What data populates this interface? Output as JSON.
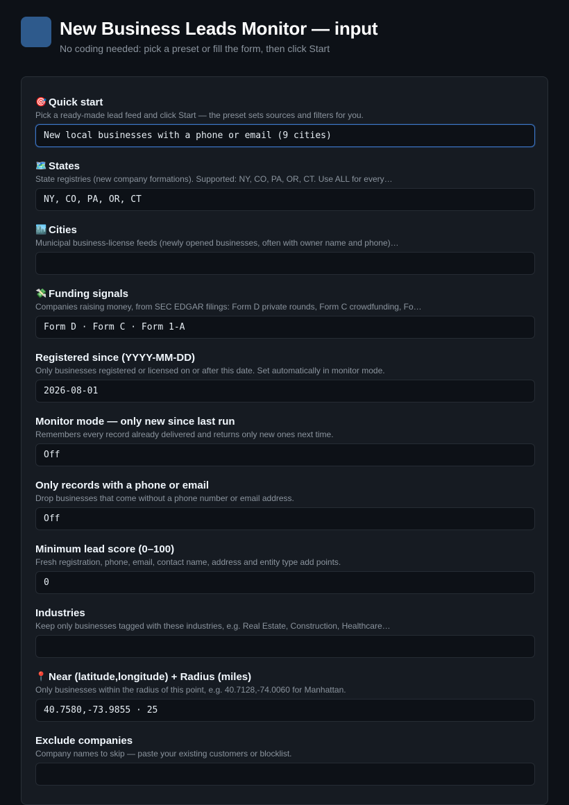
{
  "header": {
    "title": "New Business Leads Monitor — input",
    "subtitle": "No coding needed: pick a preset or fill the form, then click Start"
  },
  "fields": [
    {
      "icon": "target-icon",
      "emoji": "🎯",
      "label": "Quick start",
      "help": "Pick a ready-made lead feed and click Start — the preset sets sources and filters for you.",
      "value": "New local businesses with a phone or email (9 cities)",
      "focused": true
    },
    {
      "icon": "map-icon",
      "emoji": "🗺️",
      "label": "States",
      "help": "State registries (new company formations). Supported: NY, CO, PA, OR, CT. Use ALL for every…",
      "value": "NY, CO, PA, OR, CT"
    },
    {
      "icon": "cityscape-icon",
      "emoji": "🏙️",
      "label": "Cities",
      "help": "Municipal business-license feeds (newly opened businesses, often with owner name and phone)…",
      "value": ""
    },
    {
      "icon": "money-wings-icon",
      "emoji": "💸",
      "label": "Funding signals",
      "help": "Companies raising money, from SEC EDGAR filings: Form D private rounds, Form C crowdfunding, Fo…",
      "value": "Form D · Form C · Form 1-A"
    },
    {
      "label": "Registered since (YYYY-MM-DD)",
      "help": "Only businesses registered or licensed on or after this date. Set automatically in monitor mode.",
      "value": "2026-08-01"
    },
    {
      "label": "Monitor mode — only new since last run",
      "help": "Remembers every record already delivered and returns only new ones next time.",
      "value": "Off"
    },
    {
      "label": "Only records with a phone or email",
      "help": "Drop businesses that come without a phone number or email address.",
      "value": "Off"
    },
    {
      "label": "Minimum lead score (0–100)",
      "help": "Fresh registration, phone, email, contact name, address and entity type add points.",
      "value": "0"
    },
    {
      "label": "Industries",
      "help": "Keep only businesses tagged with these industries, e.g. Real Estate, Construction, Healthcare…",
      "value": ""
    },
    {
      "icon": "pin-icon",
      "emoji": "📍",
      "label": "Near (latitude,longitude) + Radius (miles)",
      "help": "Only businesses within the radius of this point, e.g. 40.7128,-74.0060 for Manhattan.",
      "value": "40.7580,-73.9855 · 25"
    },
    {
      "label": "Exclude companies",
      "help": "Company names to skip — paste your existing customers or blocklist.",
      "value": ""
    }
  ]
}
